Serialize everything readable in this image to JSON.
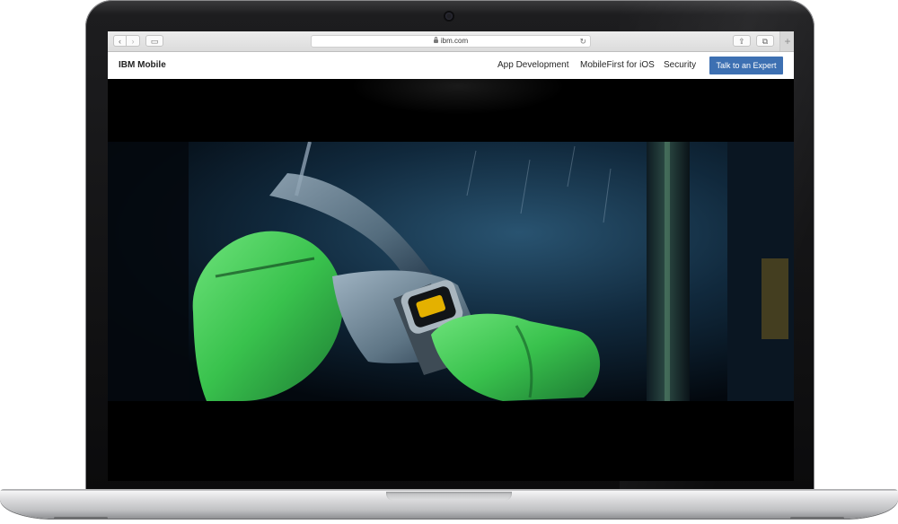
{
  "browser": {
    "url": "ibm.com",
    "back_glyph": "‹",
    "forward_glyph": "›",
    "sidebar_glyph": "▭",
    "share_glyph": "⇪",
    "tabs_glyph": "⧉",
    "new_tab_glyph": "+",
    "reload_glyph": "↻"
  },
  "site": {
    "brand": "IBM Mobile",
    "nav": {
      "app_development": "App Development",
      "mobilefirst": "MobileFirst for iOS",
      "security": "Security"
    },
    "cta_label": "Talk to an Expert",
    "cta_color": "#3d70b2"
  },
  "hero": {
    "media": "video still: gloved hands in green safety gloves with a smartwatch showing an alert, dark blue industrial scene"
  },
  "icons": {
    "camera": "camera-icon",
    "lock": "lock-icon",
    "reload": "reload-icon"
  },
  "colors": {
    "lid": "#1d1d1f",
    "screen_background": "#000000",
    "toolbar": "#e3e3e3",
    "nav_background": "#ffffff",
    "glove_green": "#49d05a",
    "watch_face_alert": "#e4b100"
  }
}
